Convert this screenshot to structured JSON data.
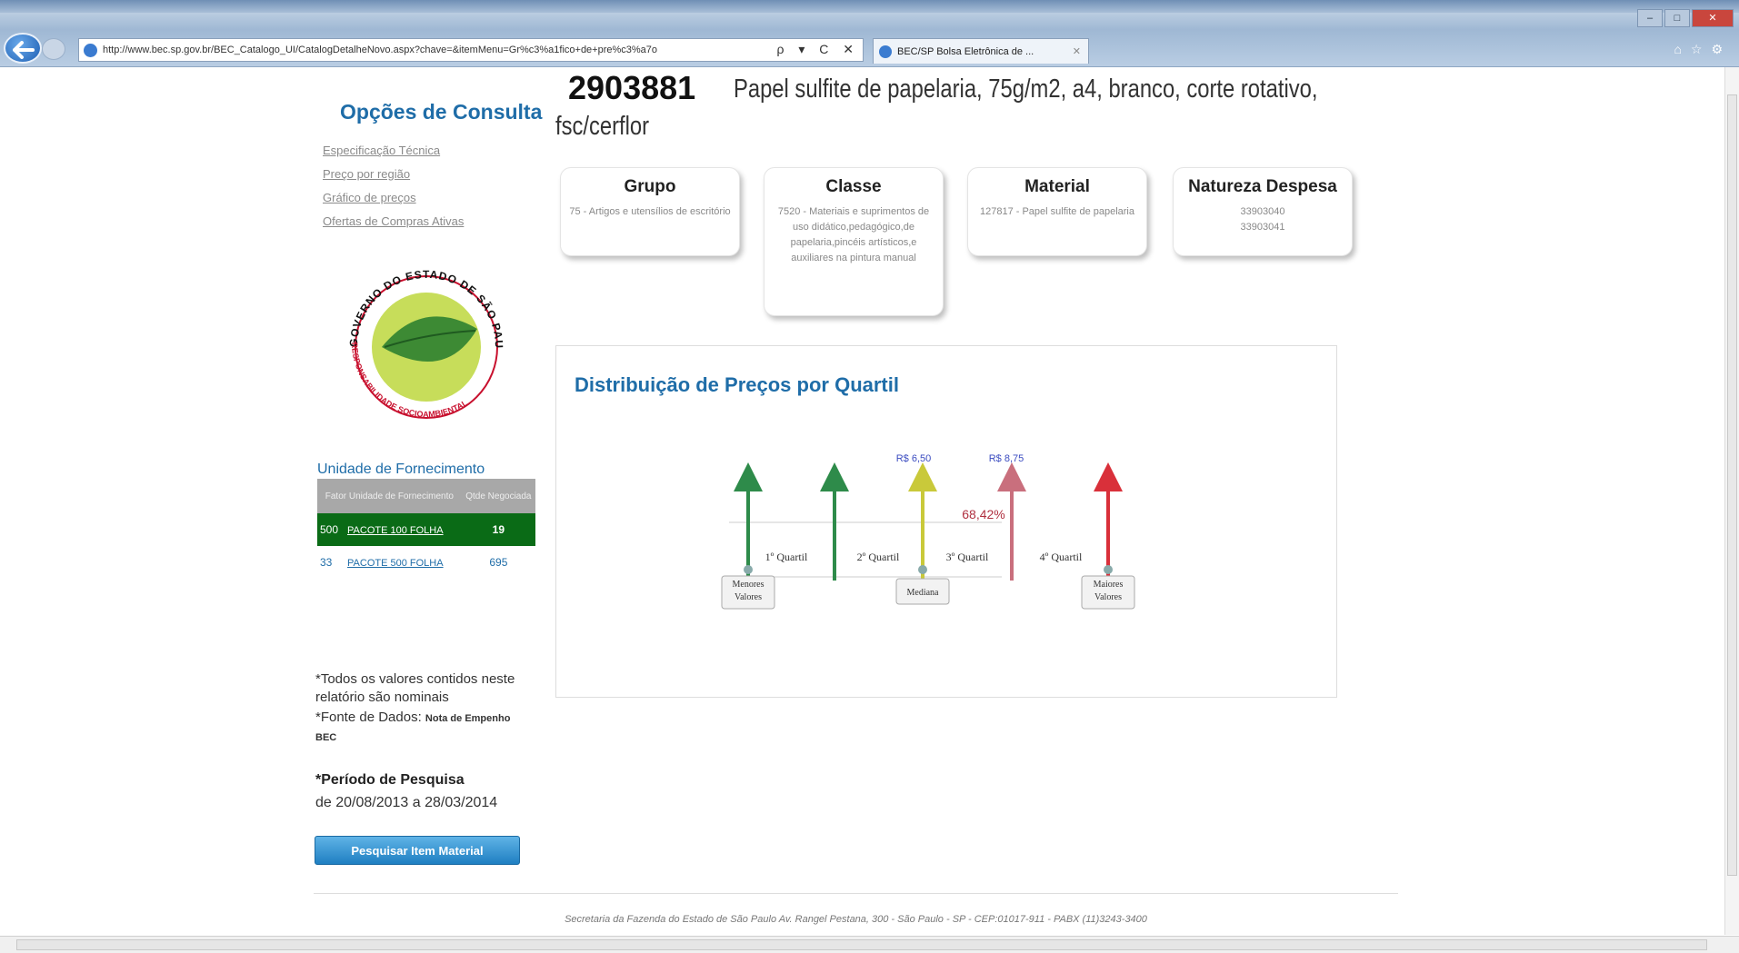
{
  "browser": {
    "url": "http://www.bec.sp.gov.br/BEC_Catalogo_UI/CatalogDetalheNovo.aspx?chave=&itemMenu=Gr%c3%a1fico+de+pre%c3%a7o",
    "tab_title": "BEC/SP Bolsa Eletrônica de ...",
    "addr_buttons": "ρ ▾ C ✕"
  },
  "sidebar": {
    "title": "Opções de Consulta",
    "links": [
      "Especificação Técnica",
      "Preço por região",
      "Gráfico de preços",
      "Ofertas de Compras Ativas"
    ]
  },
  "seal": {
    "top_text": "GOVERNO DO ESTADO DE SÃO PAULO",
    "bottom_text": "RESPONSABILIDADE SOCIOAMBIENTAL"
  },
  "unidade": {
    "title": "Unidade de Fornecimento",
    "headers": [
      "Fator Unidade de Fornecimento",
      "Qtde Negociada"
    ],
    "rows": [
      {
        "fator": "500",
        "unidade": "PACOTE 100 FOLHA",
        "qtde": "19",
        "selected": true
      },
      {
        "fator": "33",
        "unidade": "PACOTE 500 FOLHA",
        "qtde": "695",
        "selected": false
      }
    ]
  },
  "notes": {
    "line1": "*Todos os valores contidos neste relatório são nominais",
    "fonte_label": "*Fonte de Dados:",
    "fonte_value": "Nota de Empenho BEC",
    "periodo_label": "*Período de Pesquisa",
    "periodo_value": "de 20/08/2013 a 28/03/2014"
  },
  "search_button": "Pesquisar Item Material",
  "item": {
    "code": "2903881",
    "description_line1": "Papel sulfite de papelaria, 75g/m2, a4, branco, corte rotativo,",
    "description_line2": "fsc/cerflor"
  },
  "cards": [
    {
      "title": "Grupo",
      "text": "75 - Artigos e utensílios de escritório"
    },
    {
      "title": "Classe",
      "text": "7520 - Materiais e suprimentos de uso didático,pedagógico,de papelaria,pincéis artísticos,e auxiliares na pintura manual"
    },
    {
      "title": "Material",
      "text": "127817 - Papel sulfite de papelaria"
    },
    {
      "title": "Natureza  Despesa",
      "text": "33903040 33903041"
    }
  ],
  "chart": {
    "title": "Distribuição de Preços por Quartil",
    "price_labels": [
      "R$ 6,50",
      "R$ 8,75"
    ],
    "percent_label": "68,42%",
    "quartiles": [
      "1º Quartil",
      "2º Quartil",
      "3º Quartil",
      "4º Quartil"
    ],
    "markers": [
      "Menores Valores",
      "Mediana",
      "Maiores Valores"
    ],
    "colors": {
      "green": "#2e8b4a",
      "yellow": "#c9c93a",
      "pink": "#c96f7d",
      "red": "#d9303a",
      "percent": "#b03040",
      "price": "#3b4cc0"
    }
  },
  "footer": "Secretaria da Fazenda do Estado de São Paulo Av. Rangel Pestana, 300 - São Paulo - SP - CEP:01017-911 - PABX (11)3243-3400"
}
